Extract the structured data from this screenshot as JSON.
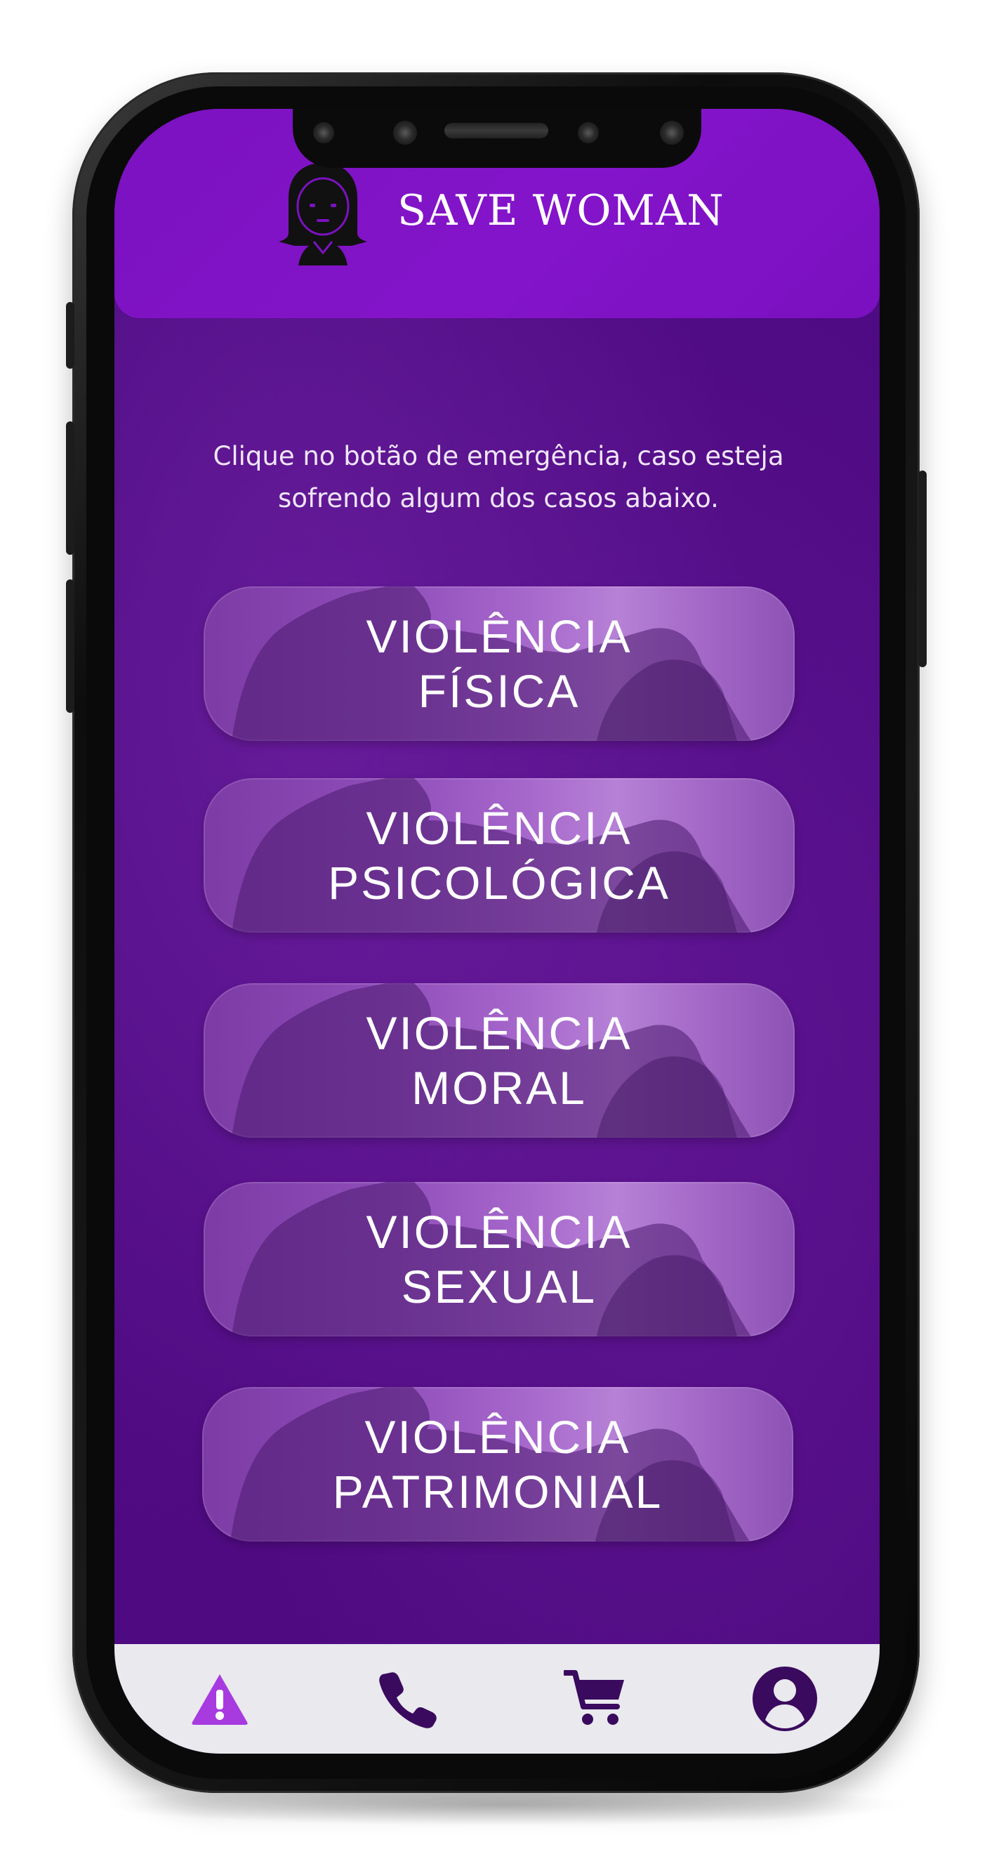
{
  "app": {
    "title": "SAVE WOMAN",
    "intro_text": "Clique no botão de emergência, caso esteja sofrendo algum dos casos abaixo."
  },
  "categories": [
    {
      "line1": "VIOLÊNCIA",
      "line2": "FÍSICA"
    },
    {
      "line1": "VIOLÊNCIA",
      "line2": "PSICOLÓGICA"
    },
    {
      "line1": "VIOLÊNCIA",
      "line2": "MORAL"
    },
    {
      "line1": "VIOLÊNCIA",
      "line2": "SEXUAL"
    },
    {
      "line1": "VIOLÊNCIA",
      "line2": "PATRIMONIAL"
    }
  ],
  "nav": [
    {
      "icon": "warning-icon",
      "active": true
    },
    {
      "icon": "phone-icon",
      "active": false
    },
    {
      "icon": "cart-icon",
      "active": false
    },
    {
      "icon": "user-icon",
      "active": false
    }
  ],
  "colors": {
    "header": "#8414ca",
    "background": "#520c86",
    "nav_active": "#a83be0",
    "nav_inactive": "#3a0a5e",
    "navbar": "#e9e9ee"
  }
}
